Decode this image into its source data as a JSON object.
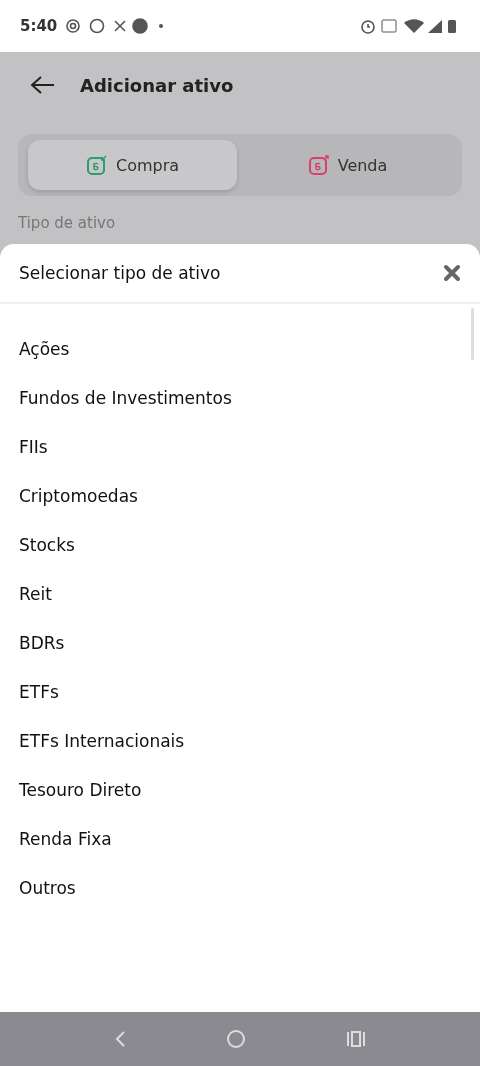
{
  "status_bar": {
    "time": "5:40"
  },
  "header": {
    "title": "Adicionar ativo"
  },
  "tabs": [
    {
      "label": "Compra",
      "kind": "buy",
      "selected": true
    },
    {
      "label": "Venda",
      "kind": "sell",
      "selected": false
    }
  ],
  "field_label": "Tipo de ativo",
  "sheet": {
    "title": "Selecionar tipo de ativo",
    "items": [
      "Ações",
      "Fundos de Investimentos",
      "FIIs",
      "Criptomoedas",
      "Stocks",
      "Reit",
      "BDRs",
      "ETFs",
      "ETFs Internacionais",
      "Tesouro Direto",
      "Renda Fixa",
      "Outros"
    ]
  }
}
